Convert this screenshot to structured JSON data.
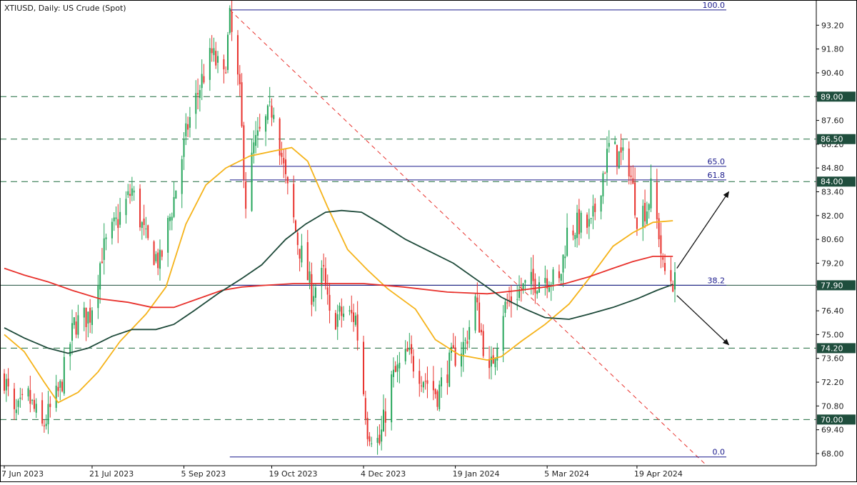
{
  "title": "XTIUSD, Daily:  US Crude (Spot)",
  "chart_data": {
    "type": "candlestick",
    "symbol": "XTIUSD",
    "timeframe": "Daily",
    "instrument": "US Crude (Spot)",
    "ylim": [
      67.2,
      94.6
    ],
    "y_ticks": [
      68.0,
      69.4,
      70.8,
      72.2,
      73.6,
      75.0,
      76.4,
      77.8,
      79.2,
      80.6,
      82.0,
      83.4,
      84.8,
      86.2,
      87.6,
      89.0,
      90.4,
      91.8,
      93.2
    ],
    "x_ticks": [
      "7 Jun 2023",
      "21 Jul 2023",
      "5 Sep 2023",
      "19 Oct 2023",
      "4 Dec 2023",
      "19 Jan 2024",
      "5 Mar 2024",
      "19 Apr 2024"
    ],
    "x_range": [
      "2023-06-07",
      "2024-05-08"
    ],
    "grid": false,
    "candles": {
      "up_color": "#26a65b",
      "down_color": "#e8322d",
      "daily_close_path": [
        [
          "2023-06-07",
          72.5
        ],
        [
          "2023-06-12",
          70.1
        ],
        [
          "2023-06-19",
          71.3
        ],
        [
          "2023-06-26",
          69.5
        ],
        [
          "2023-07-05",
          71.8
        ],
        [
          "2023-07-12",
          75.6
        ],
        [
          "2023-07-20",
          76.2
        ],
        [
          "2023-07-26",
          79.8
        ],
        [
          "2023-08-04",
          82.0
        ],
        [
          "2023-08-10",
          83.5
        ],
        [
          "2023-08-17",
          80.5
        ],
        [
          "2023-08-24",
          79.2
        ],
        [
          "2023-08-31",
          83.0
        ],
        [
          "2023-09-07",
          87.3
        ],
        [
          "2023-09-14",
          90.0
        ],
        [
          "2023-09-19",
          91.5
        ],
        [
          "2023-09-25",
          90.0
        ],
        [
          "2023-09-28",
          93.5
        ],
        [
          "2023-10-03",
          89.0
        ],
        [
          "2023-10-06",
          82.8
        ],
        [
          "2023-10-10",
          86.0
        ],
        [
          "2023-10-16",
          87.5
        ],
        [
          "2023-10-20",
          88.5
        ],
        [
          "2023-10-26",
          84.0
        ],
        [
          "2023-11-01",
          80.5
        ],
        [
          "2023-11-08",
          77.5
        ],
        [
          "2023-11-14",
          78.5
        ],
        [
          "2023-11-17",
          75.9
        ],
        [
          "2023-11-24",
          76.2
        ],
        [
          "2023-11-30",
          76.0
        ],
        [
          "2023-12-06",
          69.5
        ],
        [
          "2023-12-12",
          68.6
        ],
        [
          "2023-12-18",
          72.3
        ],
        [
          "2023-12-26",
          73.8
        ],
        [
          "2024-01-03",
          72.5
        ],
        [
          "2024-01-10",
          71.5
        ],
        [
          "2024-01-17",
          73.5
        ],
        [
          "2024-01-24",
          74.5
        ],
        [
          "2024-01-29",
          77.0
        ],
        [
          "2024-02-05",
          72.5
        ],
        [
          "2024-02-12",
          76.5
        ],
        [
          "2024-02-19",
          77.5
        ],
        [
          "2024-02-26",
          78.0
        ],
        [
          "2024-03-04",
          78.5
        ],
        [
          "2024-03-11",
          78.0
        ],
        [
          "2024-03-15",
          81.0
        ],
        [
          "2024-03-21",
          81.5
        ],
        [
          "2024-03-27",
          81.3
        ],
        [
          "2024-04-02",
          84.5
        ],
        [
          "2024-04-05",
          86.0
        ],
        [
          "2024-04-10",
          85.5
        ],
        [
          "2024-04-15",
          85.0
        ],
        [
          "2024-04-19",
          82.0
        ],
        [
          "2024-04-24",
          82.5
        ],
        [
          "2024-04-26",
          83.5
        ],
        [
          "2024-04-30",
          81.0
        ],
        [
          "2024-05-02",
          78.8
        ],
        [
          "2024-05-06",
          78.3
        ],
        [
          "2024-05-08",
          78.0
        ]
      ]
    },
    "series": [
      {
        "color": "#f5b31a",
        "values": [
          [
            "2023-06-07",
            75.0
          ],
          [
            "2023-06-17",
            74.0
          ],
          [
            "2023-06-27",
            72.2
          ],
          [
            "2023-07-04",
            71.0
          ],
          [
            "2023-07-14",
            71.6
          ],
          [
            "2023-07-24",
            72.8
          ],
          [
            "2023-08-04",
            74.6
          ],
          [
            "2023-08-17",
            76.2
          ],
          [
            "2023-08-27",
            77.8
          ],
          [
            "2023-09-06",
            81.5
          ],
          [
            "2023-09-16",
            83.8
          ],
          [
            "2023-09-26",
            84.8
          ],
          [
            "2023-10-08",
            85.5
          ],
          [
            "2023-10-20",
            85.8
          ],
          [
            "2023-10-29",
            86.0
          ],
          [
            "2023-11-06",
            85.2
          ],
          [
            "2023-11-16",
            82.5
          ],
          [
            "2023-11-26",
            80.0
          ],
          [
            "2023-12-06",
            78.8
          ],
          [
            "2023-12-16",
            77.7
          ],
          [
            "2023-12-30",
            76.5
          ],
          [
            "2024-01-09",
            74.7
          ],
          [
            "2024-01-21",
            73.8
          ],
          [
            "2024-02-04",
            73.5
          ],
          [
            "2024-02-11",
            73.7
          ],
          [
            "2024-02-21",
            74.6
          ],
          [
            "2024-03-04",
            75.6
          ],
          [
            "2024-03-16",
            76.8
          ],
          [
            "2024-03-28",
            78.6
          ],
          [
            "2024-04-07",
            80.2
          ],
          [
            "2024-04-17",
            81.0
          ],
          [
            "2024-04-27",
            81.6
          ],
          [
            "2024-05-07",
            81.7
          ]
        ]
      },
      {
        "color": "#e8322d",
        "values": [
          [
            "2023-06-07",
            78.9
          ],
          [
            "2023-06-17",
            78.5
          ],
          [
            "2023-06-29",
            78.1
          ],
          [
            "2023-07-11",
            77.6
          ],
          [
            "2023-07-25",
            77.1
          ],
          [
            "2023-08-08",
            76.9
          ],
          [
            "2023-08-20",
            76.6
          ],
          [
            "2023-08-31",
            76.6
          ],
          [
            "2023-09-12",
            77.1
          ],
          [
            "2023-09-24",
            77.6
          ],
          [
            "2023-10-04",
            77.8
          ],
          [
            "2023-10-16",
            77.9
          ],
          [
            "2023-10-30",
            78.0
          ],
          [
            "2023-11-12",
            78.0
          ],
          [
            "2023-12-04",
            78.0
          ],
          [
            "2023-12-24",
            77.8
          ],
          [
            "2024-01-15",
            77.5
          ],
          [
            "2024-02-04",
            77.4
          ],
          [
            "2024-02-20",
            77.6
          ],
          [
            "2024-03-04",
            77.8
          ],
          [
            "2024-03-14",
            78.0
          ],
          [
            "2024-03-26",
            78.4
          ],
          [
            "2024-04-07",
            78.9
          ],
          [
            "2024-04-17",
            79.3
          ],
          [
            "2024-04-27",
            79.6
          ],
          [
            "2024-05-07",
            79.6
          ]
        ]
      },
      {
        "color": "#1e4a3a",
        "values": [
          [
            "2023-06-07",
            75.4
          ],
          [
            "2023-06-17",
            74.8
          ],
          [
            "2023-06-29",
            74.2
          ],
          [
            "2023-07-09",
            73.9
          ],
          [
            "2023-07-19",
            74.2
          ],
          [
            "2023-07-31",
            74.9
          ],
          [
            "2023-08-10",
            75.3
          ],
          [
            "2023-08-22",
            75.3
          ],
          [
            "2023-08-31",
            75.6
          ],
          [
            "2023-09-10",
            76.4
          ],
          [
            "2023-09-22",
            77.4
          ],
          [
            "2023-10-04",
            78.3
          ],
          [
            "2023-10-14",
            79.1
          ],
          [
            "2023-10-26",
            80.6
          ],
          [
            "2023-11-05",
            81.5
          ],
          [
            "2023-11-15",
            82.2
          ],
          [
            "2023-11-23",
            82.3
          ],
          [
            "2023-12-03",
            82.2
          ],
          [
            "2023-12-13",
            81.5
          ],
          [
            "2023-12-25",
            80.6
          ],
          [
            "2024-01-06",
            79.9
          ],
          [
            "2024-01-18",
            79.2
          ],
          [
            "2024-01-30",
            78.2
          ],
          [
            "2024-02-11",
            77.2
          ],
          [
            "2024-02-23",
            76.5
          ],
          [
            "2024-03-04",
            76.0
          ],
          [
            "2024-03-16",
            75.9
          ],
          [
            "2024-03-26",
            76.2
          ],
          [
            "2024-04-07",
            76.6
          ],
          [
            "2024-04-19",
            77.1
          ],
          [
            "2024-04-29",
            77.6
          ],
          [
            "2024-05-07",
            77.95
          ]
        ]
      }
    ],
    "horizontal_levels": [
      {
        "value": 89.0,
        "label": "89.00"
      },
      {
        "value": 86.5,
        "label": "86.50"
      },
      {
        "value": 84.0,
        "label": "84.00"
      },
      {
        "value": 74.2,
        "label": "74.20"
      },
      {
        "value": 70.0,
        "label": "70.00"
      }
    ],
    "current_price": {
      "value": 77.9,
      "label": "77.90"
    },
    "fibonacci": {
      "start": [
        "2023-09-28",
        94.1
      ],
      "end": [
        "2024-05-06",
        67.8
      ],
      "right_edge": "2024-05-08",
      "levels": [
        {
          "label": "100.0",
          "value": 94.1
        },
        {
          "label": "65.0",
          "value": 84.9
        },
        {
          "label": "61.8",
          "value": 84.1
        },
        {
          "label": "38.2",
          "value": 77.9
        },
        {
          "label": "0.0",
          "value": 67.8
        }
      ]
    },
    "arrows": [
      {
        "from": [
          "2024-05-09",
          78.9
        ],
        "to": [
          "2024-06-04",
          83.4
        ]
      },
      {
        "from": [
          "2024-05-09",
          77.3
        ],
        "to": [
          "2024-06-04",
          74.4
        ]
      }
    ]
  }
}
